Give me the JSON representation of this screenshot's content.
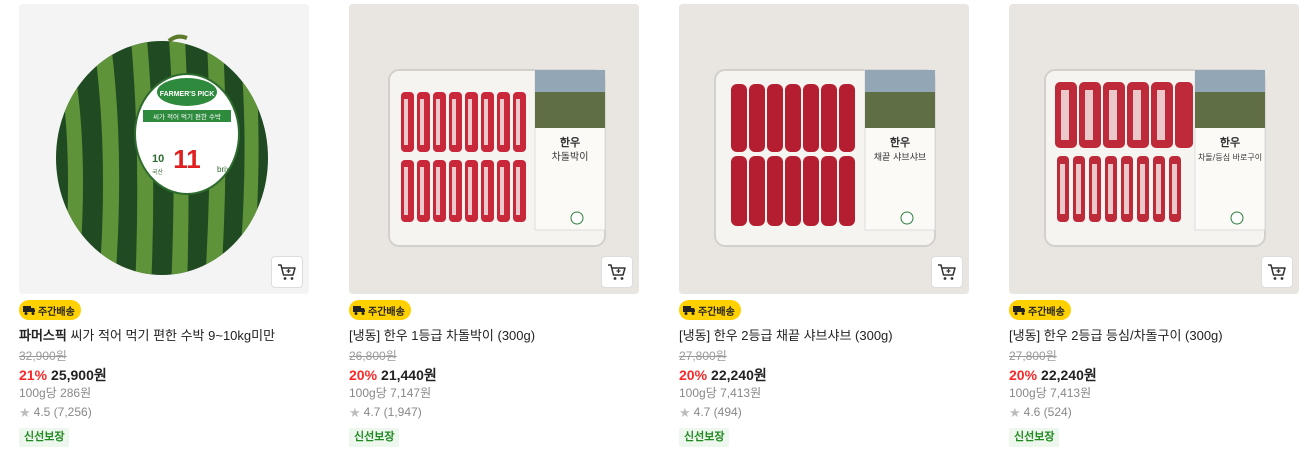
{
  "products": [
    {
      "badge": "주간배송",
      "brand": "파머스픽",
      "name": "씨가 적어 먹기 편한 수박 9~10kg미만",
      "original_price": "32,900원",
      "discount": "21%",
      "price": "25,900원",
      "unit_price": "100g당 286원",
      "rating": "4.5 (7,256)",
      "tag": "신선보장",
      "image_icon": "watermelon-icon",
      "label_lines": {
        "top": "FARMER'S PICK",
        "sub": "씨가 적어 먹기 편한 수박",
        "brix_left": "10",
        "brix_big": "11",
        "brix": "brix",
        "kr": "국산"
      }
    },
    {
      "badge": "주간배송",
      "brand": "",
      "name": "[냉동] 한우 1등급 차돌박이 (300g)",
      "original_price": "26,800원",
      "discount": "20%",
      "price": "21,440원",
      "unit_price": "100g당 7,147원",
      "rating": "4.7 (1,947)",
      "tag": "신선보장",
      "image_icon": "beef-tray-icon",
      "label_lines": {
        "title": "한우",
        "sub": "차돌박이"
      }
    },
    {
      "badge": "주간배송",
      "brand": "",
      "name": "[냉동] 한우 2등급 채끝 샤브샤브 (300g)",
      "original_price": "27,800원",
      "discount": "20%",
      "price": "22,240원",
      "unit_price": "100g당 7,413원",
      "rating": "4.7 (494)",
      "tag": "신선보장",
      "image_icon": "beef-tray-icon",
      "label_lines": {
        "title": "한우",
        "sub": "채끝 샤브샤브"
      }
    },
    {
      "badge": "주간배송",
      "brand": "",
      "name": "[냉동] 한우 2등급 등심/차돌구이 (300g)",
      "original_price": "27,800원",
      "discount": "20%",
      "price": "22,240원",
      "unit_price": "100g당 7,413원",
      "rating": "4.6 (524)",
      "tag": "신선보장",
      "image_icon": "beef-tray-icon",
      "label_lines": {
        "title": "한우",
        "sub": "차돌/등심 바로구이"
      }
    }
  ],
  "colors": {
    "discount": "#fa2828",
    "badge": "#ffd100",
    "fresh_text": "#1e8a1e"
  }
}
